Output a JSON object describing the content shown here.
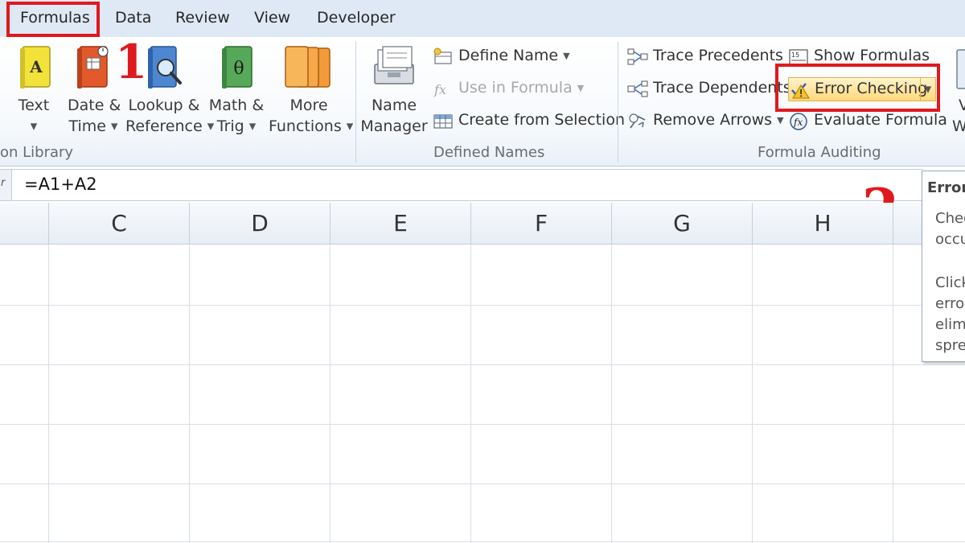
{
  "tabs": [
    {
      "label": "Formulas",
      "active": true
    },
    {
      "label": "Data"
    },
    {
      "label": "Review"
    },
    {
      "label": "View"
    },
    {
      "label": "Developer"
    }
  ],
  "function_library": {
    "group_label": "on Library",
    "buttons": [
      {
        "line1": "Text",
        "line2": "",
        "icon": "text-book-icon"
      },
      {
        "line1": "Date &",
        "line2": "Time",
        "icon": "date-time-book-icon"
      },
      {
        "line1": "Lookup &",
        "line2": "Reference",
        "icon": "lookup-reference-book-icon"
      },
      {
        "line1": "Math &",
        "line2": "Trig",
        "icon": "math-trig-book-icon"
      },
      {
        "line1": "More",
        "line2": "Functions",
        "icon": "more-functions-books-icon"
      }
    ]
  },
  "defined_names": {
    "group_label": "Defined Names",
    "name_manager": {
      "line1": "Name",
      "line2": "Manager"
    },
    "define_name": "Define Name",
    "use_in_formula": "Use in Formula",
    "create_from_selection": "Create from Selection"
  },
  "formula_auditing": {
    "group_label": "Formula Auditing",
    "trace_precedents": "Trace Precedents",
    "trace_dependents": "Trace Dependents",
    "remove_arrows": "Remove Arrows",
    "show_formulas": "Show Formulas",
    "error_checking": "Error Checking",
    "evaluate_formula": "Evaluate Formula",
    "watch_window": {
      "line1": "V",
      "line2": "W"
    }
  },
  "formula_bar": {
    "value": "=A1+A2",
    "namebox_edge": "r"
  },
  "columns": [
    "C",
    "D",
    "E",
    "F",
    "G",
    "H"
  ],
  "annotations": {
    "step1": "1",
    "step2": "2",
    "color": "#e0191e"
  },
  "tooltip": {
    "title": "Error",
    "lines": [
      "Chec",
      "occu",
      "",
      "Click",
      "erro",
      "elim",
      "spre"
    ]
  }
}
